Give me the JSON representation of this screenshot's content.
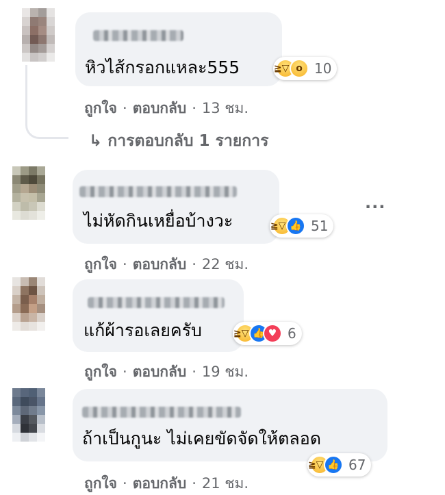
{
  "comments": [
    {
      "text": "หิวไส้กรอกแหละ555",
      "reaction_count": "10",
      "like_label": "ถูกใจ",
      "reply_label": "ตอบกลับ",
      "time": "13 ชม.",
      "reactions": [
        "haha",
        "wow"
      ]
    },
    {
      "text": "ไม่หัดกินเหยื่อบ้างวะ",
      "reaction_count": "51",
      "like_label": "ถูกใจ",
      "reply_label": "ตอบกลับ",
      "time": "22 ชม.",
      "reactions": [
        "haha",
        "like"
      ]
    },
    {
      "text": "แก้ผ้ารอเลยครับ",
      "reaction_count": "6",
      "like_label": "ถูกใจ",
      "reply_label": "ตอบกลับ",
      "time": "19 ชม.",
      "reactions": [
        "haha",
        "like",
        "love"
      ]
    },
    {
      "text": "ถ้าเป็นกูนะ ไม่เคยขัดจัดให้ตลอด",
      "reaction_count": "67",
      "like_label": "ถูกใจ",
      "reply_label": "ตอบกลับ",
      "time": "21 ชม.",
      "reactions": [
        "haha",
        "like"
      ]
    }
  ],
  "reply_link": {
    "arrow": "↳",
    "label": "การตอบกลับ 1 รายการ"
  },
  "more_menu": {
    "label": "···"
  },
  "separator": "·",
  "colors": {
    "bubble": "#f0f2f5",
    "meta_text": "#65676b",
    "like_blue": "#1877f2",
    "love_red": "#f33e58",
    "haha_yellow": "#f7b125"
  },
  "icons": {
    "haha": "haha-reaction-icon",
    "wow": "wow-reaction-icon",
    "like": "like-reaction-icon",
    "love": "love-reaction-icon"
  }
}
